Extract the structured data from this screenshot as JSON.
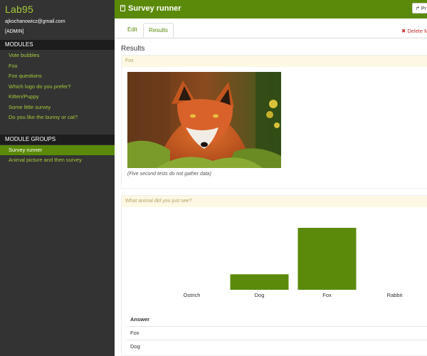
{
  "sidebar": {
    "brand": "Lab95",
    "email": "ajkochanowicz@gmail.com",
    "role": "[ADMIN]",
    "modules_header": "MODULES",
    "modules": [
      "Vote bubbles",
      "Fox",
      "Fox questions",
      "Which logo do you prefer?",
      "Kitten/Puppy",
      "Some little survey",
      "Do you like the bunny or cat?"
    ],
    "groups_header": "MODULE GROUPS",
    "groups": [
      "Survey runner",
      "Animal picture and then survey"
    ],
    "active_group": "Survey runner"
  },
  "topbar": {
    "title": "Survey runner",
    "preview_label": "Pr"
  },
  "tabs": {
    "edit": "Edit",
    "results": "Results",
    "delete": "Delete M"
  },
  "main": {
    "heading": "Results",
    "panel1_title": "Fox",
    "caption": "(Five second tests do not gather data)",
    "panel2_title": "What animal did you just see?"
  },
  "chart_data": {
    "type": "bar",
    "categories": [
      "Ostrich",
      "Dog",
      "Fox",
      "Rabbit"
    ],
    "values": [
      0,
      1,
      4,
      0
    ],
    "ylim": [
      0,
      4
    ],
    "bar_color": "#5b8a0a"
  },
  "answers": {
    "header": "Answer",
    "rows": [
      "Fox",
      "Dog"
    ]
  },
  "colors": {
    "accent": "#5b8a0a",
    "sidebar_bg": "#333333",
    "link_green": "#a6c93a"
  }
}
